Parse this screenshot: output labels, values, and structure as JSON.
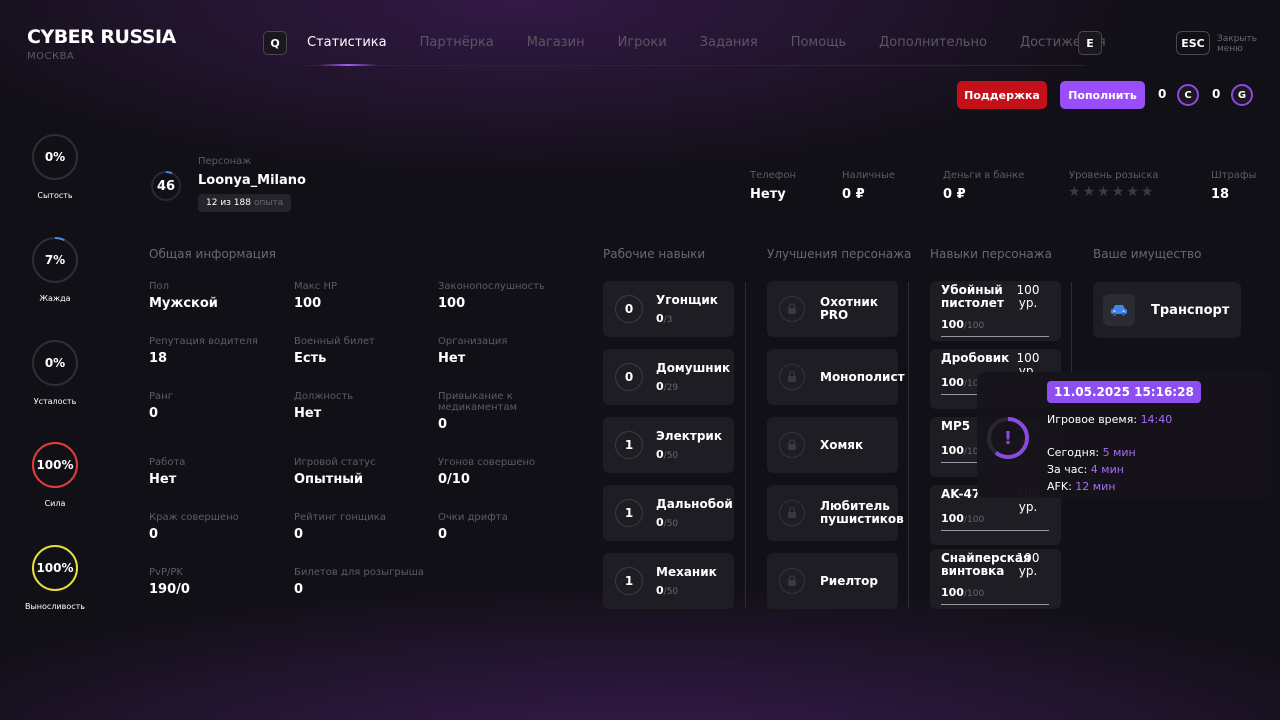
{
  "header": {
    "brand": "CYBER RUSSIA",
    "city": "МОСКВА",
    "key_left": "Q",
    "key_right": "E",
    "esc": "ESC",
    "close_label": "Закрыть меню",
    "tabs": [
      "Статистика",
      "Партнёрка",
      "Магазин",
      "Игроки",
      "Задания",
      "Помощь",
      "Дополнительно",
      "Достижения"
    ]
  },
  "actions": {
    "support": "Поддержка",
    "topup": "Пополнить",
    "coin1_amount": "0",
    "coin1_letter": "C",
    "coin2_amount": "0",
    "coin2_letter": "G"
  },
  "needs": [
    {
      "label": "Сытость",
      "value": "0%",
      "level": 0,
      "color": "#3a3840"
    },
    {
      "label": "Жажда",
      "value": "7%",
      "level": 7,
      "color": "#3b8cf0"
    },
    {
      "label": "Усталость",
      "value": "0%",
      "level": 0,
      "color": "#3a3840"
    },
    {
      "label": "Сила",
      "value": "100%",
      "level": 100,
      "color": "#e23b3b"
    },
    {
      "label": "Выносливость",
      "value": "100%",
      "level": 100,
      "color": "#e8dd3a"
    }
  ],
  "character": {
    "level": "46",
    "name_label": "Персонаж",
    "name": "Loonya_Milano",
    "xp": "12 из 188",
    "xp_unit": "опыта"
  },
  "top_stats": [
    {
      "label": "Телефон",
      "value": "Нету"
    },
    {
      "label": "Наличные",
      "value": "0 ₽"
    },
    {
      "label": "Деньги в банке",
      "value": "0 ₽"
    },
    {
      "label": "Уровень розыска",
      "stars": 0
    },
    {
      "label": "Штрафы",
      "value": "18"
    }
  ],
  "sections": {
    "general": "Общая информация",
    "work": "Рабочие навыки",
    "upgrades": "Улучшения персонажа",
    "skills": "Навыки персонажа",
    "property": "Ваше имущество"
  },
  "general": [
    [
      {
        "label": "Пол",
        "value": "Мужской"
      },
      {
        "label": "Макс HP",
        "value": "100"
      },
      {
        "label": "Законопослушность",
        "value": "100"
      }
    ],
    [
      {
        "label": "Репутация водителя",
        "value": "18"
      },
      {
        "label": "Военный билет",
        "value": "Есть"
      },
      {
        "label": "Организация",
        "value": "Нет"
      }
    ],
    [
      {
        "label": "Ранг",
        "value": "0"
      },
      {
        "label": "Должность",
        "value": "Нет"
      },
      {
        "label": "Привыкание к медикаментам",
        "value": "0"
      }
    ],
    [
      {
        "label": "Работа",
        "value": "Нет"
      },
      {
        "label": "Игровой статус",
        "value": "Опытный"
      },
      {
        "label": "Угонов совершено",
        "value": "0/10"
      }
    ],
    [
      {
        "label": "Краж совершено",
        "value": "0"
      },
      {
        "label": "Рейтинг гонщика",
        "value": "0"
      },
      {
        "label": "Очки дрифта",
        "value": "0"
      }
    ],
    [
      {
        "label": "PvP/PK",
        "value": "190/0"
      },
      {
        "label": "Билетов для розыгрыша",
        "value": "0"
      }
    ]
  ],
  "work_skills": [
    {
      "level": "0",
      "name": "Угонщик",
      "progress": "0",
      "max": "/3"
    },
    {
      "level": "0",
      "name": "Домушник",
      "progress": "0",
      "max": "/29"
    },
    {
      "level": "1",
      "name": "Электрик",
      "progress": "0",
      "max": "/50"
    },
    {
      "level": "1",
      "name": "Дальнобой",
      "progress": "0",
      "max": "/50"
    },
    {
      "level": "1",
      "name": "Механик",
      "progress": "0",
      "max": "/50"
    }
  ],
  "upgrades": [
    "Охотник PRO",
    "Монополист",
    "Хомяк",
    "Любитель пушистиков",
    "Риелтор"
  ],
  "skills": [
    {
      "name": "Убойный пистолет",
      "price": "100 ур.",
      "value": "100",
      "max": "/100"
    },
    {
      "name": "Дробовик",
      "price": "100 ур.",
      "value": "100",
      "max": "/100"
    },
    {
      "name": "MP5",
      "price": "100 ур.",
      "value": "100",
      "max": "/100"
    },
    {
      "name": "AK-47",
      "price": "100 ур.",
      "value": "100",
      "max": "/100"
    },
    {
      "name": "Снайперская винтовка",
      "price": "100 ур.",
      "value": "100",
      "max": "/100"
    }
  ],
  "property": [
    {
      "name": "Транспорт",
      "icon": "car-icon"
    }
  ],
  "tooltip": {
    "datetime": "11.05.2025 15:16:28",
    "icon": "!",
    "playtime_label": "Игровое время:",
    "playtime": "14:40",
    "today_label": "Сегодня:",
    "today": "5 мин",
    "hour_label": "За час:",
    "hour": "4 мин",
    "afk_label": "AFK:",
    "afk": "12 мин"
  }
}
